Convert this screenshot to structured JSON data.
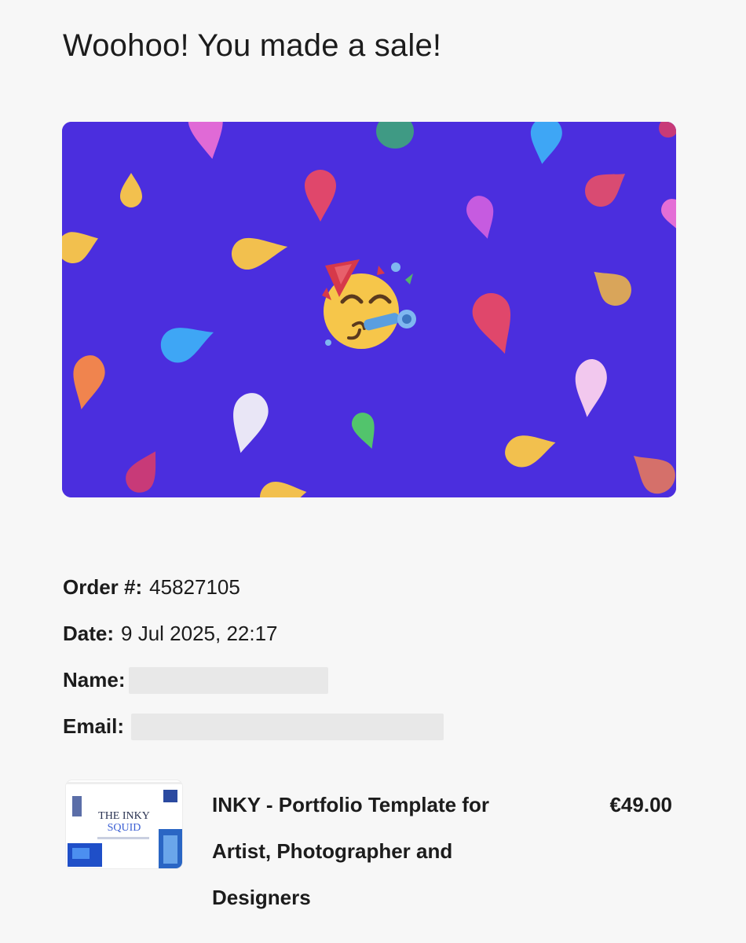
{
  "email": {
    "heading": "Woohoo! You made a sale!",
    "hero": {
      "image": "celebration-banner",
      "background_color": "#4b2ede",
      "emoji": "partying-face-icon"
    },
    "order": {
      "number_label": "Order #:",
      "number_value": "45827105",
      "date_label": "Date:",
      "date_value": "9 Jul 2025, 22:17",
      "name_label": "Name:",
      "name_value_redacted": true,
      "email_label": "Email:",
      "email_value_redacted": true
    },
    "product": {
      "thumbnail_title": "THE INKY",
      "thumbnail_subtitle": "SQUID",
      "name": "INKY - Portfolio Template for Artist, Photographer and Designers",
      "price": "€49.00"
    }
  }
}
